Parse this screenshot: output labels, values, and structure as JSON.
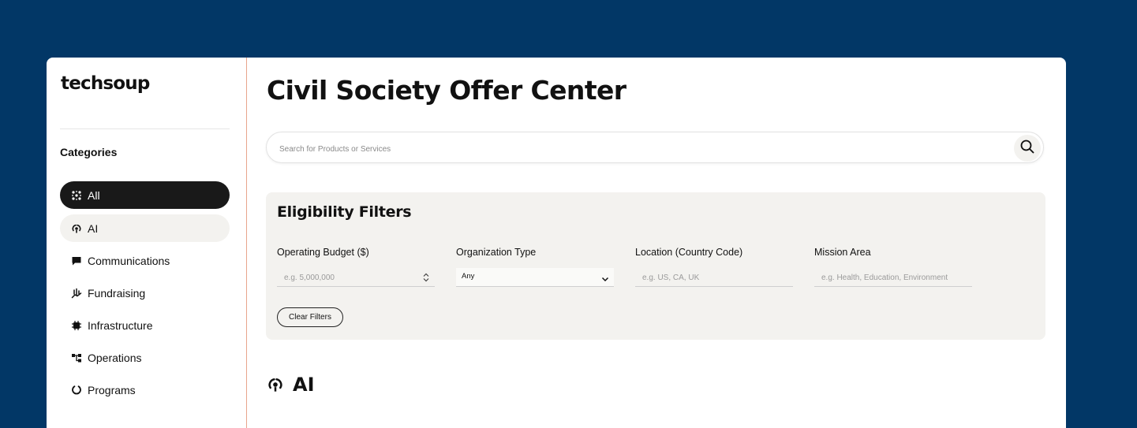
{
  "brand": {
    "logo_text": "techsoup"
  },
  "sidebar": {
    "heading": "Categories",
    "items": [
      {
        "label": "All",
        "icon": "sparkle-grid-icon",
        "state": "active"
      },
      {
        "label": "AI",
        "icon": "ai-cycle-icon",
        "state": "hover"
      },
      {
        "label": "Communications",
        "icon": "chat-bubble-icon",
        "state": ""
      },
      {
        "label": "Fundraising",
        "icon": "hand-coins-icon",
        "state": ""
      },
      {
        "label": "Infrastructure",
        "icon": "chip-icon",
        "state": ""
      },
      {
        "label": "Operations",
        "icon": "workflow-icon",
        "state": ""
      },
      {
        "label": "Programs",
        "icon": "ring-icon",
        "state": ""
      }
    ]
  },
  "main": {
    "title": "Civil Society Offer Center",
    "search": {
      "placeholder": "Search for Products or Services",
      "value": ""
    },
    "filters": {
      "title": "Eligibility Filters",
      "fields": [
        {
          "label": "Operating Budget ($)",
          "placeholder": "e.g. 5,000,000",
          "type": "number"
        },
        {
          "label": "Organization Type",
          "value": "Any",
          "type": "select"
        },
        {
          "label": "Location (Country Code)",
          "placeholder": "e.g. US, CA, UK",
          "type": "text"
        },
        {
          "label": "Mission Area",
          "placeholder": "e.g. Health, Education, Environment",
          "type": "text"
        }
      ],
      "clear_label": "Clear Filters"
    },
    "section": {
      "title": "AI",
      "icon": "ai-cycle-icon"
    }
  },
  "colors": {
    "page_background": "#023766",
    "active_pill": "#191919",
    "filter_panel": "#f3f2ef",
    "sidebar_border": "#e8a48c"
  }
}
